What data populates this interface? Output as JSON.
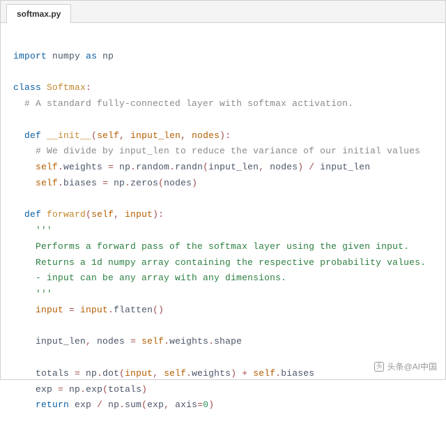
{
  "tab": {
    "filename": "softmax.py"
  },
  "code": {
    "l1": {
      "kw_import": "import",
      "numpy": "numpy",
      "kw_as": "as",
      "np": "np"
    },
    "l3": {
      "kw_class": "class",
      "name": "Softmax",
      "colon": ":"
    },
    "l4": {
      "comment": "# A standard fully-connected layer with softmax activation."
    },
    "l6": {
      "kw_def": "def",
      "fn": "__init__",
      "lp": "(",
      "p1": "self",
      "c1": ", ",
      "p2": "input_len",
      "c2": ", ",
      "p3": "nodes",
      "rp": ")",
      "colon": ":"
    },
    "l7": {
      "comment": "# We divide by input_len to reduce the variance of our initial values"
    },
    "l8": {
      "self": "self",
      "d1": ".",
      "weights": "weights",
      "eq": " = ",
      "np": "np",
      "d2": ".",
      "random": "random",
      "d3": ".",
      "randn": "randn",
      "lp": "(",
      "a1": "input_len",
      "c1": ", ",
      "a2": "nodes",
      "rp": ")",
      "div": " / ",
      "il": "input_len"
    },
    "l9": {
      "self": "self",
      "d1": ".",
      "biases": "biases",
      "eq": " = ",
      "np": "np",
      "d2": ".",
      "zeros": "zeros",
      "lp": "(",
      "a1": "nodes",
      "rp": ")"
    },
    "l11": {
      "kw_def": "def",
      "fn": "forward",
      "lp": "(",
      "p1": "self",
      "c1": ", ",
      "p2": "input",
      "rp": ")",
      "colon": ":"
    },
    "l12": {
      "triple": "'''"
    },
    "l13": {
      "doc": "Performs a forward pass of the softmax layer using the given input."
    },
    "l14": {
      "doc": "Returns a 1d numpy array containing the respective probability values."
    },
    "l15": {
      "doc": "- input can be any array with any dimensions."
    },
    "l16": {
      "triple": "'''"
    },
    "l17": {
      "input": "input",
      "eq": " = ",
      "input2": "input",
      "d1": ".",
      "flatten": "flatten",
      "lp": "(",
      "rp": ")"
    },
    "l19": {
      "il": "input_len",
      "c1": ", ",
      "nodes": "nodes",
      "eq": " = ",
      "self": "self",
      "d1": ".",
      "weights": "weights",
      "d2": ".",
      "shape": "shape"
    },
    "l21": {
      "totals": "totals",
      "eq": " = ",
      "np": "np",
      "d1": ".",
      "dot": "dot",
      "lp": "(",
      "a1": "input",
      "c1": ", ",
      "self": "self",
      "d2": ".",
      "weights": "weights",
      "rp": ")",
      "plus": " + ",
      "self2": "self",
      "d3": ".",
      "biases": "biases"
    },
    "l22": {
      "exp": "exp",
      "eq": " = ",
      "np": "np",
      "d1": ".",
      "expf": "exp",
      "lp": "(",
      "a1": "totals",
      "rp": ")"
    },
    "l23": {
      "kw_return": "return",
      "exp": "exp",
      "div": " / ",
      "np": "np",
      "d1": ".",
      "sum": "sum",
      "lp": "(",
      "a1": "exp",
      "c1": ", ",
      "axis": "axis",
      "eq2": "=",
      "zero": "0",
      "rp": ")"
    }
  },
  "watermark": {
    "text": "头条@AI中国"
  }
}
